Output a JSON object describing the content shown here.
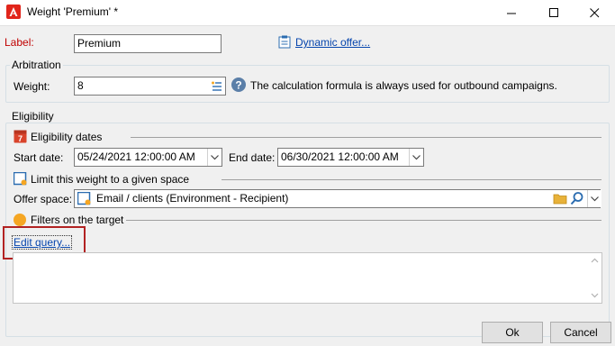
{
  "window": {
    "title": "Weight 'Premium' *",
    "app_icon": "adobe-icon",
    "controls": [
      "minimize-icon",
      "maximize-icon",
      "close-icon"
    ]
  },
  "form": {
    "label_caption": "Label:",
    "label_value": "Premium",
    "dynamic_offer_link": "Dynamic offer...",
    "arbitration": {
      "title": "Arbitration",
      "weight_caption": "Weight:",
      "weight_value": "8",
      "help_text": "The calculation formula is always used for outbound campaigns."
    },
    "eligibility": {
      "title": "Eligibility",
      "dates_section": "Eligibility dates",
      "start_caption": "Start date:",
      "start_value": "05/24/2021 12:00:00 AM",
      "end_caption": "End date:",
      "end_value": "06/30/2021 12:00:00 AM",
      "limit_checkbox_label": "Limit this weight to a given space",
      "offer_space_caption": "Offer space:",
      "offer_space_value": "Email / clients (Environment - Recipient)",
      "filters_section": "Filters on the target",
      "edit_query_link": "Edit query..."
    }
  },
  "buttons": {
    "ok": "Ok",
    "cancel": "Cancel"
  },
  "colors": {
    "label_red": "#c00000",
    "link_blue": "#0645ad",
    "highlight_box": "#b22222",
    "calendar_red": "#d9432b",
    "filter_orange": "#f5a623"
  }
}
